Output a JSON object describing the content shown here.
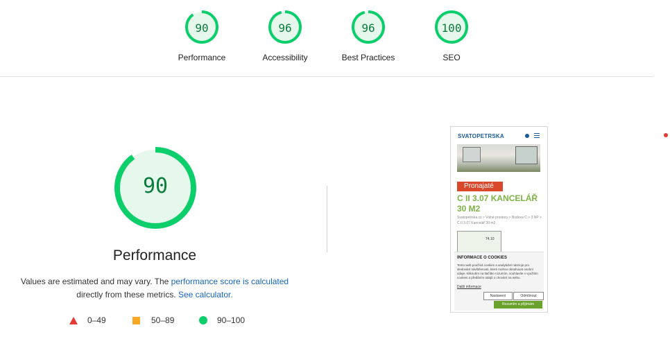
{
  "gauges": [
    {
      "score": "90",
      "label": "Performance",
      "fraction": 0.9
    },
    {
      "score": "96",
      "label": "Accessibility",
      "fraction": 0.96
    },
    {
      "score": "96",
      "label": "Best Practices",
      "fraction": 0.96
    },
    {
      "score": "100",
      "label": "SEO",
      "fraction": 1.0
    }
  ],
  "main": {
    "score": "90",
    "fraction": 0.9,
    "title": "Performance",
    "desc_text1": "Values are estimated and may vary. The ",
    "desc_link1": "performance score is calculated",
    "desc_text2": "directly from these metrics. ",
    "desc_link2": "See calculator."
  },
  "legend": [
    {
      "label": "0–49",
      "icon": "red-triangle"
    },
    {
      "label": "50–89",
      "icon": "orange-square"
    },
    {
      "label": "90–100",
      "icon": "green-circle"
    }
  ],
  "colors": {
    "pass": "#0cce6b",
    "pass_bg": "#e6f8ec",
    "pass_text": "#0a7c3b",
    "link": "#1565c0",
    "fail": "#e53935",
    "average": "#f9a825"
  },
  "phone": {
    "logo": "SVATOPETRSKA",
    "badge": "Pronajaté",
    "title": "C II 3.07 KANCELÁŘ 30 M2",
    "breadcrumb": "Svatopetrska.cz > Volné prostory > Budova C > 3.NP > C II 3.07 Kancelář 30 m2",
    "plan_label": "74.10",
    "cookie": {
      "title": "INFORMACE O COOKIES",
      "text": "Tento web používá cookies a analytické nástroje pro sledování návštěvnosti, které mohou obsahovat osobní údaje. Kliknutím na tlačítko rozumím, souhlasíte s využitím cookies a předáním údajů o chování na webu.",
      "more": "Další informace",
      "settings": "Nastavení",
      "reject": "Odmítnout",
      "accept": "Rozumím a přijímám"
    }
  }
}
